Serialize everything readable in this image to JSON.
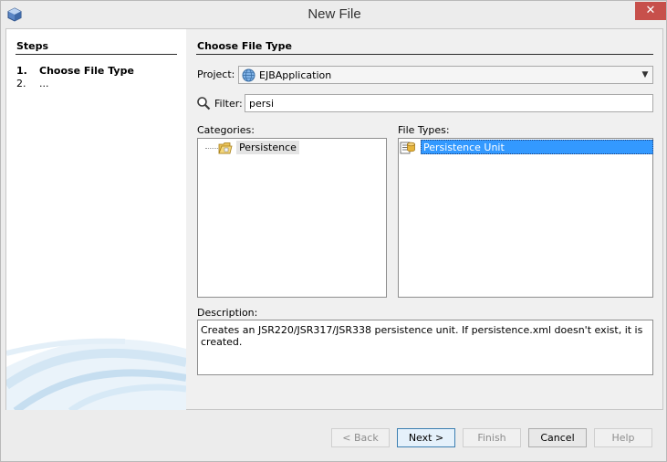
{
  "window": {
    "title": "New File",
    "close_glyph": "✕",
    "icon": "netbeans-cube-icon"
  },
  "steps": {
    "title": "Steps",
    "items": [
      {
        "num": "1.",
        "label": "Choose File Type",
        "current": true
      },
      {
        "num": "2.",
        "label": "...",
        "current": false
      }
    ]
  },
  "main": {
    "section_title": "Choose File Type",
    "project_label": "Project:",
    "project_value": "EJBApplication",
    "project_icon": "globe-icon",
    "filter_label": "Filter:",
    "filter_value": "persi",
    "filter_icon": "magnifier-icon",
    "categories_label": "Categories:",
    "categories": [
      {
        "label": "Persistence",
        "icon": "folder-icon"
      }
    ],
    "file_types_label": "File Types:",
    "file_types": [
      {
        "label": "Persistence Unit",
        "icon": "persistence-unit-icon",
        "selected": true
      }
    ],
    "description_label": "Description:",
    "description": "Creates an JSR220/JSR317/JSR338 persistence unit. If persistence.xml doesn't exist, it is created."
  },
  "buttons": {
    "back": "< Back",
    "next": "Next >",
    "finish": "Finish",
    "cancel": "Cancel",
    "help": "Help"
  },
  "colors": {
    "selection": "#3399ff",
    "close": "#c7504b"
  }
}
